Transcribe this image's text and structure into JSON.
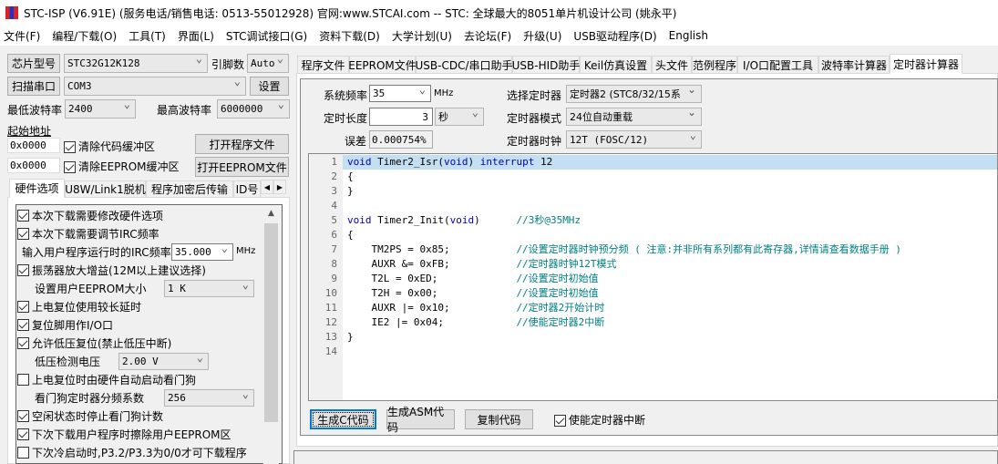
{
  "title": "STC-ISP (V6.91E) (服务电话/销售电话: 0513-55012928) 官网:www.STCAI.com  -- STC: 全球最大的8051单片机设计公司 (姚永平)",
  "menu": [
    "文件(F)",
    "编程/下载(O)",
    "工具(T)",
    "界面(L)",
    "STC调试接口(G)",
    "资料下载(D)",
    "大学计划(U)",
    "去论坛(F)",
    "升级(U)",
    "USB驱动程序(D)",
    "English"
  ],
  "left": {
    "chip_button": "芯片型号",
    "chip_value": "STC32G12K128",
    "pins_label": "引脚数",
    "pins_value": "Auto",
    "scan_button": "扫描串口",
    "port_value": "COM3",
    "settings_button": "设置",
    "min_baud_label": "最低波特率",
    "min_baud_value": "2400",
    "max_baud_label": "最高波特率",
    "max_baud_value": "6000000",
    "start_addr_label": "起始地址",
    "addr1": "0x0000",
    "clear_code_label": "清除代码缓冲区",
    "open_prog_button": "打开程序文件",
    "addr2": "0x0000",
    "clear_eeprom_label": "清除EEPROM缓冲区",
    "open_eeprom_button": "打开EEPROM文件",
    "tabs": [
      "硬件选项",
      "U8W/Link1脱机",
      "程序加密后传输",
      "ID号"
    ],
    "options": [
      {
        "label": "本次下载需要修改硬件选项",
        "checked": true
      },
      {
        "label": "本次下载需要调节IRC频率",
        "checked": true
      },
      {
        "label": "输入用户程序运行时的IRC频率",
        "value": "35.000",
        "unit": "MHz"
      },
      {
        "label": "振荡器放大增益(12M以上建议选择)",
        "checked": true
      },
      {
        "label": "设置用户EEPROM大小",
        "value": "1    K"
      },
      {
        "label": "上电复位使用较长延时",
        "checked": true
      },
      {
        "label": "复位脚用作I/O口",
        "checked": true
      },
      {
        "label": "允许低压复位(禁止低压中断)",
        "checked": true
      },
      {
        "label": "低压检测电压",
        "value": "2.00 V"
      },
      {
        "label": "上电复位时由硬件自动启动看门狗",
        "checked": false
      },
      {
        "label": "看门狗定时器分频系数",
        "value": "256"
      },
      {
        "label": "空闲状态时停止看门狗计数",
        "checked": true
      },
      {
        "label": "下次下载用户程序时擦除用户EEPROM区",
        "checked": true
      },
      {
        "label": "下次冷启动时,P3.2/P3.3为0/0才可下载程序",
        "checked": false
      }
    ]
  },
  "right": {
    "tabs": [
      "程序文件",
      "EEPROM文件",
      "USB-CDC/串口助手",
      "USB-HID助手",
      "Keil仿真设置",
      "头文件",
      "范例程序",
      "I/O口配置工具",
      "波特率计算器",
      "定时器计算器"
    ],
    "sysfreq_label": "系统频率",
    "sysfreq_value": "35",
    "sysfreq_unit": "MHz",
    "timelen_label": "定时长度",
    "timelen_value": "3",
    "timelen_unit": "秒",
    "error_label": "误差",
    "error_value": "0.000754%",
    "timer_sel_label": "选择定时器",
    "timer_sel_value": "定时器2 (STC8/32/15系",
    "timer_mode_label": "定时器模式",
    "timer_mode_value": "24位自动重载",
    "timer_clock_label": "定时器时钟",
    "timer_clock_value": "12T (FOSC/12)",
    "code": [
      "void Timer2_Isr(void) interrupt 12",
      "{",
      "}",
      "",
      "void Timer2_Init(void)      //3秒@35MHz",
      "{",
      "    TM2PS = 0x85;           //设置定时器时钟预分频 ( 注意:并非所有系列都有此寄存器,详情请查看数据手册 )",
      "    AUXR &= 0xFB;           //定时器时钟12T模式",
      "    T2L = 0xED;             //设置定时初始值",
      "    T2H = 0x00;             //设置定时初始值",
      "    AUXR |= 0x10;           //定时器2开始计时",
      "    IE2 |= 0x04;            //使能定时器2中断",
      "}",
      ""
    ],
    "gen_c_button": "生成C代码",
    "gen_asm_button": "生成ASM代码",
    "copy_button": "复制代码",
    "enable_int_label": "使能定时器中断"
  }
}
